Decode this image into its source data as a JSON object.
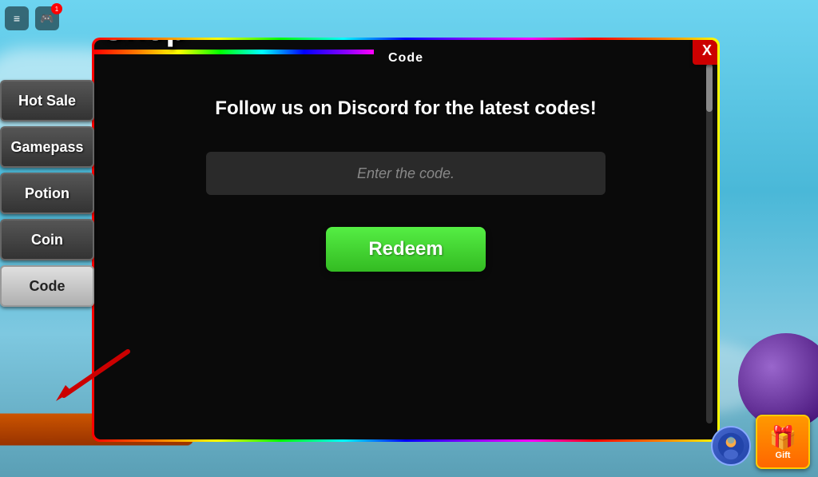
{
  "app": {
    "title": "Shop"
  },
  "topbar": {
    "icon1": "≡",
    "icon2": "🎮",
    "notification": "1"
  },
  "sidebar": {
    "items": [
      {
        "id": "hot-sale",
        "label": "Hot Sale",
        "active": false
      },
      {
        "id": "gamepass",
        "label": "Gamepass",
        "active": false
      },
      {
        "id": "potion",
        "label": "Potion",
        "active": false
      },
      {
        "id": "coin",
        "label": "Coin",
        "active": false
      },
      {
        "id": "code",
        "label": "Code",
        "active": true
      }
    ]
  },
  "shop_panel": {
    "title": "Shop",
    "close_label": "X",
    "tab_label": "Code",
    "discord_message": "Follow us on Discord for the latest codes!",
    "input_placeholder": "Enter the code.",
    "redeem_label": "Redeem"
  },
  "gift": {
    "label": "Gift",
    "icon": "🎁"
  },
  "scrollbar": {
    "visible": true
  }
}
